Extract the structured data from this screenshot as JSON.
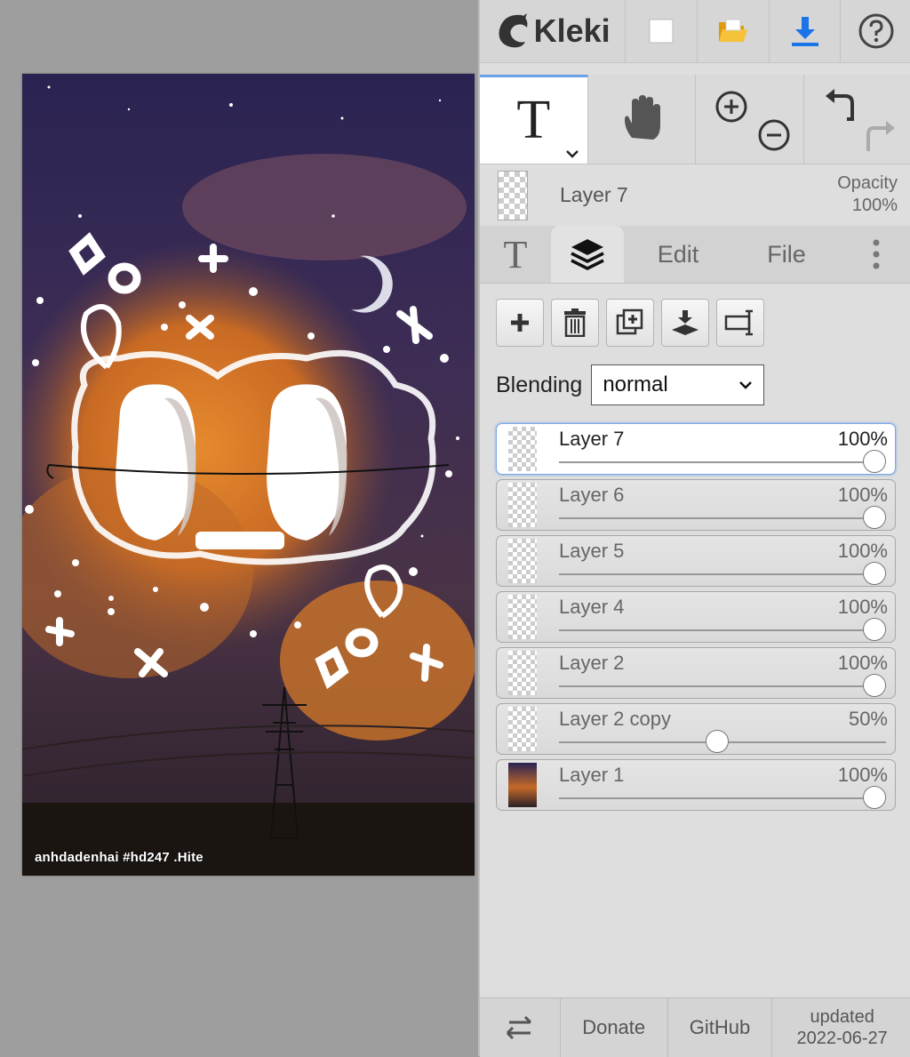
{
  "app": {
    "name": "Kleki"
  },
  "canvas": {
    "credit_text": "anhdadenhai #hd247 .Hite"
  },
  "toolbar": {
    "icons": [
      "new-image-icon",
      "open-folder-icon",
      "download-icon",
      "help-icon"
    ]
  },
  "tools": {
    "active": "text",
    "items": [
      "text-tool-icon",
      "hand-tool-icon",
      "zoom-in-icon",
      "zoom-out-icon",
      "undo-icon",
      "redo-icon"
    ]
  },
  "current_layer": {
    "name": "Layer 7",
    "opacity_label": "Opacity",
    "opacity_value": "100%"
  },
  "tabs": {
    "text_tab_symbol": "T",
    "layers_icon": "layers-icon",
    "edit": "Edit",
    "file": "File",
    "more_icon": "more-vertical-icon"
  },
  "layer_actions": [
    "add-layer-icon",
    "delete-layer-icon",
    "duplicate-layer-icon",
    "merge-down-icon",
    "rename-layer-icon"
  ],
  "blending": {
    "label": "Blending",
    "value": "normal"
  },
  "layers": [
    {
      "name": "Layer 7",
      "opacity": "100%",
      "value": 1.0,
      "selected": true
    },
    {
      "name": "Layer 6",
      "opacity": "100%",
      "value": 1.0,
      "selected": false
    },
    {
      "name": "Layer 5",
      "opacity": "100%",
      "value": 1.0,
      "selected": false
    },
    {
      "name": "Layer 4",
      "opacity": "100%",
      "value": 1.0,
      "selected": false
    },
    {
      "name": "Layer 2",
      "opacity": "100%",
      "value": 1.0,
      "selected": false
    },
    {
      "name": "Layer 2 copy",
      "opacity": "50%",
      "value": 0.5,
      "selected": false
    },
    {
      "name": "Layer 1",
      "opacity": "100%",
      "value": 1.0,
      "selected": false
    }
  ],
  "footer": {
    "swap_icon": "swap-arrows-icon",
    "donate": "Donate",
    "github": "GitHub",
    "updated_label": "updated",
    "updated_date": "2022-06-27"
  },
  "colors": {
    "accent": "#1a73e8",
    "folder": "#f2b01e",
    "selection_border": "#7aa7e8"
  }
}
